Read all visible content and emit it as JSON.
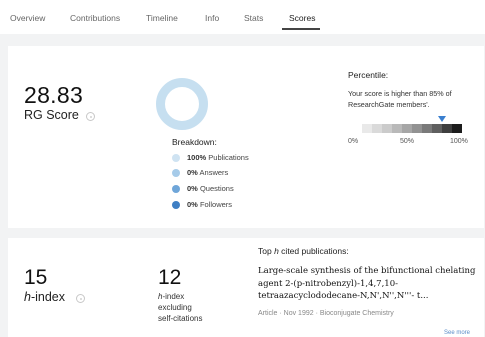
{
  "tabs": [
    "Overview",
    "Contributions",
    "Timeline",
    "Info",
    "Stats",
    "Scores"
  ],
  "active_tab": "Scores",
  "rg": {
    "score": "28.83",
    "label": "RG Score"
  },
  "breakdown": {
    "title": "Breakdown:",
    "items": [
      {
        "value": "100%",
        "label": "Publications",
        "color": "#cfe3f2"
      },
      {
        "value": "0%",
        "label": "Answers",
        "color": "#a6cbe9"
      },
      {
        "value": "0%",
        "label": "Questions",
        "color": "#6fa6d9"
      },
      {
        "value": "0%",
        "label": "Followers",
        "color": "#3f7fc4"
      }
    ],
    "donut_color": "#c6dff0"
  },
  "percentile": {
    "title": "Percentile:",
    "text": "Your score is higher than 85% of ResearchGate members'.",
    "value_percent": 85,
    "ticks": [
      "0%",
      "50%",
      "100%"
    ]
  },
  "h_index": {
    "value": "15",
    "label_letter": "h",
    "label_rest": "-index"
  },
  "h_index_excl": {
    "value": "12",
    "label_letter": "h",
    "label_line1_rest": "-index",
    "label_line2": "excluding",
    "label_line3": "self-citations"
  },
  "top_cited": {
    "title_pre": "Top ",
    "title_letter": "h",
    "title_post": " cited publications:",
    "pub_title": "Large-scale synthesis of the bifunctional chelating agent 2-(p-nitrobenzyl)-1,4,7,10-tetraazacyclododecane-N,N',N'',N'''- t...",
    "pub_meta": "Article · Nov 1992 · Bioconjugate Chemistry",
    "see_more": "See more"
  }
}
